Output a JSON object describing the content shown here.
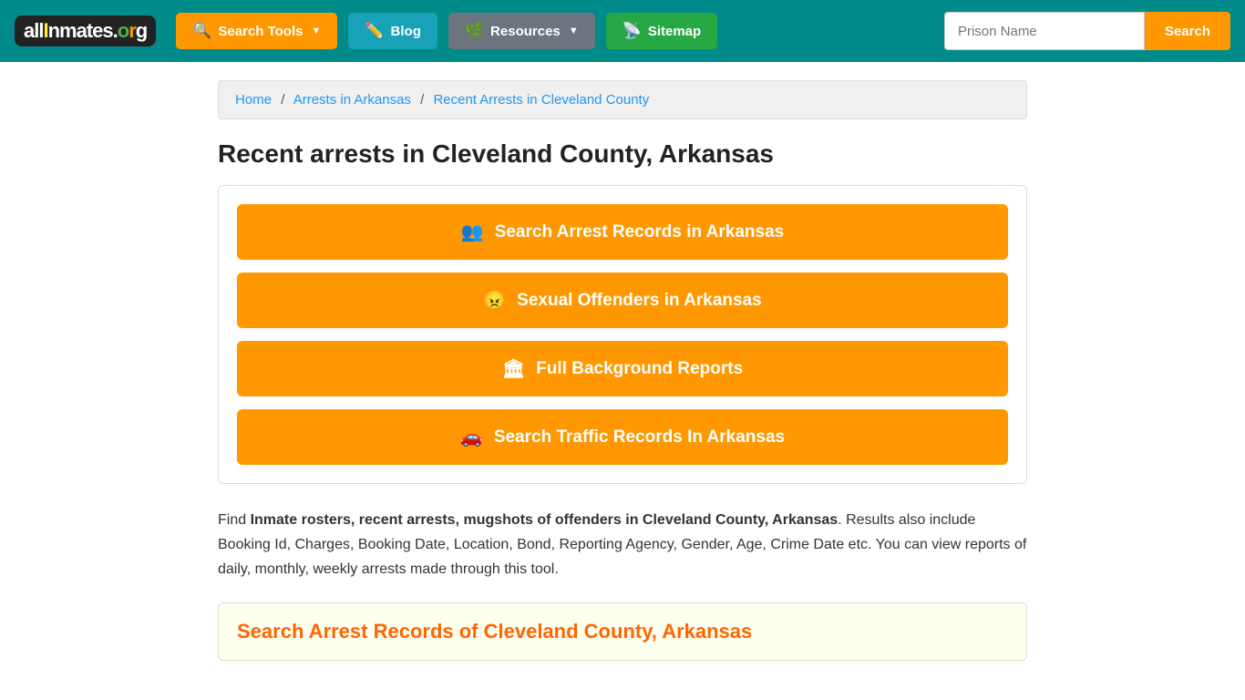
{
  "navbar": {
    "logo_text": "allInmates.org",
    "search_tools_label": "Search Tools",
    "blog_label": "Blog",
    "resources_label": "Resources",
    "sitemap_label": "Sitemap",
    "search_placeholder": "Prison Name",
    "search_button_label": "Search"
  },
  "breadcrumb": {
    "home": "Home",
    "arrests_in_arkansas": "Arrests in Arkansas",
    "current": "Recent Arrests in Cleveland County"
  },
  "page": {
    "title": "Recent arrests in Cleveland County, Arkansas",
    "buttons": [
      {
        "label": "Search Arrest Records in Arkansas",
        "icon": "👥"
      },
      {
        "label": "Sexual Offenders in Arkansas",
        "icon": "😠"
      },
      {
        "label": "Full Background Reports",
        "icon": "🏛"
      },
      {
        "label": "Search Traffic Records In Arkansas",
        "icon": "🚗"
      }
    ],
    "description_prefix": "Find ",
    "description_bold": "Inmate rosters, recent arrests, mugshots of offenders in Cleveland County, Arkansas",
    "description_suffix": ". Results also include Booking Id, Charges, Booking Date, Location, Bond, Reporting Agency, Gender, Age, Crime Date etc. You can view reports of daily, monthly, weekly arrests made through this tool.",
    "search_section_heading": "Search Arrest Records of Cleveland County, Arkansas"
  }
}
